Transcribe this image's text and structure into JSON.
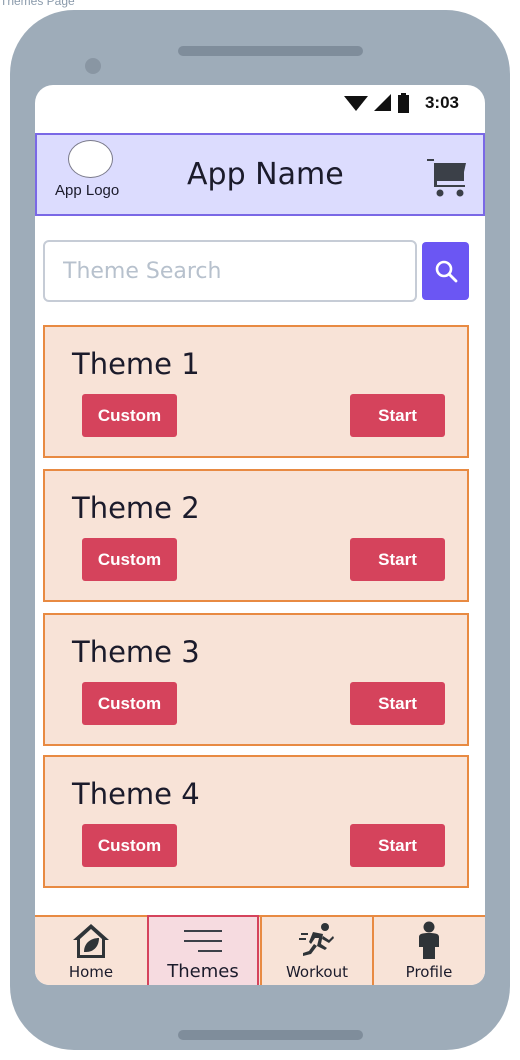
{
  "page_label": "Themes Page",
  "status_bar": {
    "time": "3:03"
  },
  "header": {
    "logo_text": "App Logo",
    "app_name": "App Name"
  },
  "search": {
    "placeholder": "Theme Search"
  },
  "themes": [
    {
      "title": "Theme 1",
      "custom_label": "Custom",
      "start_label": "Start"
    },
    {
      "title": "Theme 2",
      "custom_label": "Custom",
      "start_label": "Start"
    },
    {
      "title": "Theme 3",
      "custom_label": "Custom",
      "start_label": "Start"
    },
    {
      "title": "Theme 4",
      "custom_label": "Custom",
      "start_label": "Start"
    }
  ],
  "bottom_nav": [
    {
      "label": "Home",
      "icon": "home-icon"
    },
    {
      "label": "Themes",
      "icon": "menu-lines-icon",
      "active": true
    },
    {
      "label": "Workout",
      "icon": "running-person-icon"
    },
    {
      "label": "Profile",
      "icon": "person-icon"
    }
  ],
  "colors": {
    "header_bg": "#dcdcfe",
    "header_border": "#7a68e6",
    "card_bg": "#f8e3d7",
    "card_border": "#e88a42",
    "button_bg": "#d5435c",
    "search_button_bg": "#6b56f3",
    "phone_body": "#9eacb9"
  }
}
